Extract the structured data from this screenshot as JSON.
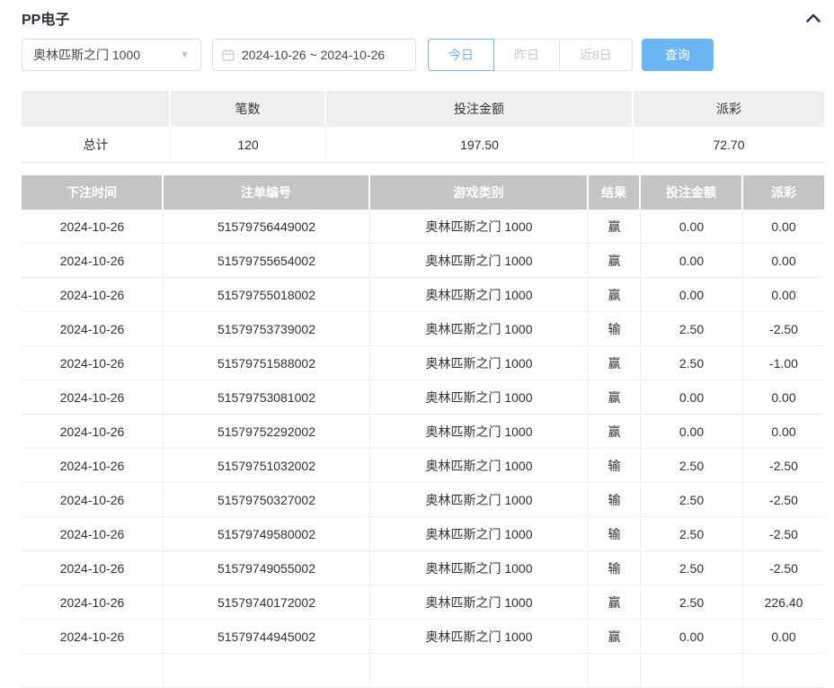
{
  "page": {
    "title": "PP电子"
  },
  "colors": {
    "accent_blue": "#6cb5f5",
    "negative_red": "#f56c6c",
    "table_header_gray": "#c4c4c4",
    "summary_header_gray": "#efefef"
  },
  "controls": {
    "game_select": {
      "value": "奥林匹斯之门 1000"
    },
    "date_range": {
      "value": "2024-10-26 ~ 2024-10-26"
    },
    "quick_buttons": [
      {
        "label": "今日",
        "active": true
      },
      {
        "label": "昨日",
        "active": false
      },
      {
        "label": "近8日",
        "active": false
      }
    ],
    "query_button_label": "查询"
  },
  "summary": {
    "headers": [
      "",
      "笔数",
      "投注金额",
      "派彩"
    ],
    "row": {
      "label": "总计",
      "count": "120",
      "bet_amount": "197.50",
      "payout": "72.70"
    }
  },
  "table": {
    "headers": [
      "下注时间",
      "注单编号",
      "游戏类别",
      "结果",
      "投注金额",
      "派彩"
    ],
    "rows": [
      [
        "2024-10-26",
        "51579756449002",
        "奥林匹斯之门 1000",
        "赢",
        "0.00",
        "0.00"
      ],
      [
        "2024-10-26",
        "51579755654002",
        "奥林匹斯之门 1000",
        "赢",
        "0.00",
        "0.00"
      ],
      [
        "2024-10-26",
        "51579755018002",
        "奥林匹斯之门 1000",
        "赢",
        "0.00",
        "0.00"
      ],
      [
        "2024-10-26",
        "51579753739002",
        "奥林匹斯之门 1000",
        "输",
        "2.50",
        "-2.50"
      ],
      [
        "2024-10-26",
        "51579751588002",
        "奥林匹斯之门 1000",
        "赢",
        "2.50",
        "-1.00"
      ],
      [
        "2024-10-26",
        "51579753081002",
        "奥林匹斯之门 1000",
        "赢",
        "0.00",
        "0.00"
      ],
      [
        "2024-10-26",
        "51579752292002",
        "奥林匹斯之门 1000",
        "赢",
        "0.00",
        "0.00"
      ],
      [
        "2024-10-26",
        "51579751032002",
        "奥林匹斯之门 1000",
        "输",
        "2.50",
        "-2.50"
      ],
      [
        "2024-10-26",
        "51579750327002",
        "奥林匹斯之门 1000",
        "输",
        "2.50",
        "-2.50"
      ],
      [
        "2024-10-26",
        "51579749580002",
        "奥林匹斯之门 1000",
        "输",
        "2.50",
        "-2.50"
      ],
      [
        "2024-10-26",
        "51579749055002",
        "奥林匹斯之门 1000",
        "输",
        "2.50",
        "-2.50"
      ],
      [
        "2024-10-26",
        "51579740172002",
        "奥林匹斯之门 1000",
        "赢",
        "2.50",
        "226.40"
      ],
      [
        "2024-10-26",
        "51579744945002",
        "奥林匹斯之门 1000",
        "赢",
        "0.00",
        "0.00"
      ]
    ]
  }
}
